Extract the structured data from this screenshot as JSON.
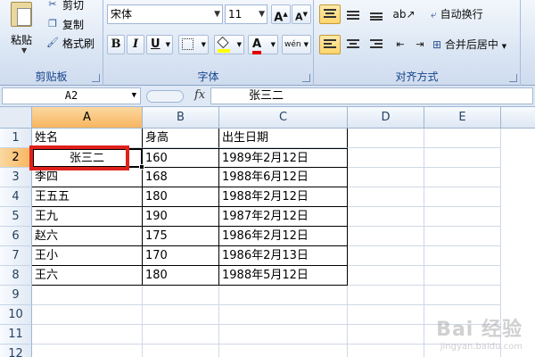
{
  "ribbon": {
    "clipboard": {
      "group_label": "剪贴板",
      "paste_label": "粘贴",
      "cut_label": "剪切",
      "copy_label": "复制",
      "format_painter_label": "格式刷"
    },
    "font": {
      "group_label": "字体",
      "font_name": "宋体",
      "font_size": "11",
      "bold": "B",
      "italic": "I",
      "underline": "U",
      "grow": "A",
      "shrink": "A",
      "font_color_glyph": "A",
      "fill_color": "#ffff00",
      "text_color": "#e00000",
      "phonetic": "wén"
    },
    "alignment": {
      "group_label": "对齐方式",
      "wrap_text_label": "自动换行",
      "merge_center_label": "合并后居中"
    }
  },
  "formula_bar": {
    "name_box": "A2",
    "fx": "fx",
    "content": "张三二"
  },
  "columns": [
    "A",
    "B",
    "C",
    "D",
    "E"
  ],
  "rows": [
    "1",
    "2",
    "3",
    "4",
    "5",
    "6",
    "7",
    "8",
    "9",
    "10",
    "11",
    "12"
  ],
  "table": {
    "headers": [
      "姓名",
      "身高",
      "出生日期"
    ],
    "records": [
      [
        "张三二",
        "160",
        "1989年2月12日"
      ],
      [
        "李四",
        "168",
        "1988年6月12日"
      ],
      [
        "王五五",
        "180",
        "1988年2月12日"
      ],
      [
        "王九",
        "190",
        "1987年2月12日"
      ],
      [
        "赵六",
        "175",
        "1986年2月12日"
      ],
      [
        "王小",
        "170",
        "1986年2月13日"
      ],
      [
        "王六",
        "180",
        "1988年5月12日"
      ]
    ]
  },
  "selected_cell": "A2",
  "accent_colors": {
    "selection_header": "#f8b560",
    "highlight_box": "#e0201a"
  },
  "watermark": {
    "text": "Bai 经验",
    "sub": "jingyan.baidu.com"
  }
}
